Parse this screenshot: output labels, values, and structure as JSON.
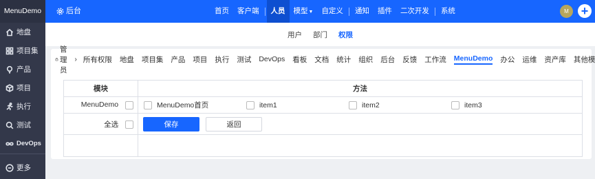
{
  "sidebar": {
    "logo": "MenuDemo",
    "items": [
      {
        "label": "地盘",
        "icon": "home-icon"
      },
      {
        "label": "项目集",
        "icon": "grid-icon"
      },
      {
        "label": "产品",
        "icon": "lightbulb-icon"
      },
      {
        "label": "项目",
        "icon": "cube-icon"
      },
      {
        "label": "执行",
        "icon": "run-icon"
      },
      {
        "label": "测试",
        "icon": "search-bug-icon"
      },
      {
        "label": "DevOps",
        "icon": "infinity-icon"
      }
    ],
    "more": {
      "label": "更多",
      "icon": "more-icon"
    }
  },
  "topbar": {
    "home_label": "后台",
    "nav": [
      "首页",
      "客户端",
      "人员",
      "模型",
      "自定义",
      "通知",
      "插件",
      "二次开发",
      "系统"
    ],
    "active": "人员",
    "avatar": "M",
    "plus": "+"
  },
  "subnav": {
    "items": [
      "用户",
      "部门",
      "权限"
    ],
    "active": "权限"
  },
  "breadcrumb": {
    "admin": "管理员",
    "items": [
      "所有权限",
      "地盘",
      "项目集",
      "产品",
      "项目",
      "执行",
      "测试",
      "DevOps",
      "看板",
      "文档",
      "统计",
      "组织",
      "后台",
      "反馈",
      "工作流",
      "MenuDemo",
      "办公",
      "运维",
      "资产库",
      "其他模块"
    ],
    "active": "MenuDemo"
  },
  "table": {
    "col_module": "模块",
    "col_method": "方法",
    "row_module": "MenuDemo",
    "methods": [
      "MenuDemo首页",
      "item1",
      "item2",
      "item3"
    ],
    "select_all": "全选",
    "save": "保存",
    "back": "返回"
  },
  "colors": {
    "accent": "#1766ff",
    "sidebar": "#33384a"
  }
}
